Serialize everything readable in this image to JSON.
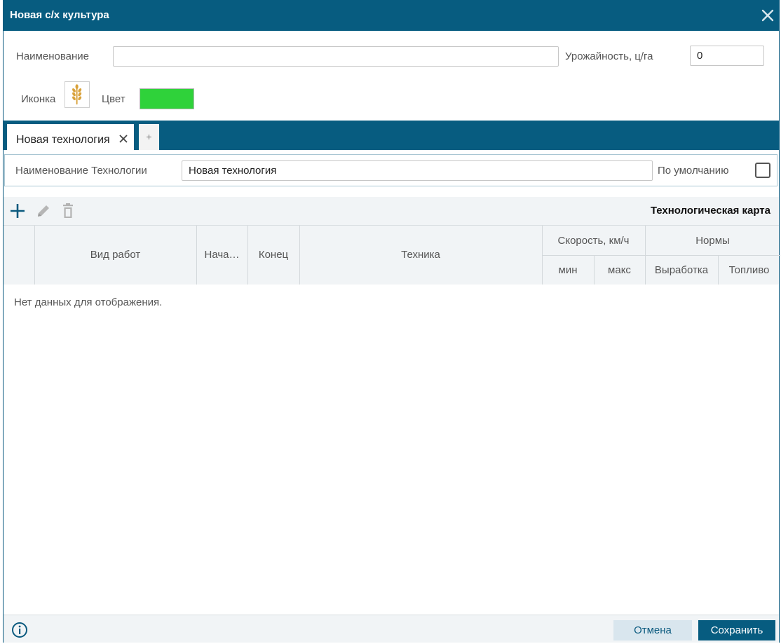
{
  "window": {
    "title": "Новая с/х культура",
    "accent_color": "#075c80"
  },
  "form": {
    "name_label": "Наименование",
    "name_value": "",
    "yield_label": "Урожайность, ц/га",
    "yield_value": "0",
    "icon_label": "Иконка",
    "icon_name": "wheat-icon",
    "color_label": "Цвет",
    "color_value": "#2fd23a"
  },
  "tabs": {
    "items": [
      {
        "label": "Новая технология",
        "active": true
      }
    ],
    "add_label": "+"
  },
  "technology": {
    "name_label": "Наименование Технологии",
    "name_value": "Новая технология",
    "default_label": "По умолчанию",
    "default_checked": false
  },
  "toolbar": {
    "add_icon": "plus-icon",
    "edit_icon": "pencil-icon",
    "delete_icon": "trash-icon",
    "section_title": "Технологическая карта"
  },
  "grid": {
    "columns": {
      "work_type": "Вид работ",
      "start": "Нача…",
      "end": "Конец",
      "machinery": "Техника",
      "speed": "Скорость, км/ч",
      "speed_min": "мин",
      "speed_max": "макс",
      "norms": "Нормы",
      "norms_output": "Выработка",
      "norms_fuel": "Топливо"
    },
    "empty_text": "Нет данных для отображения."
  },
  "footer": {
    "info_icon": "info-icon",
    "cancel_label": "Отмена",
    "save_label": "Сохранить"
  }
}
